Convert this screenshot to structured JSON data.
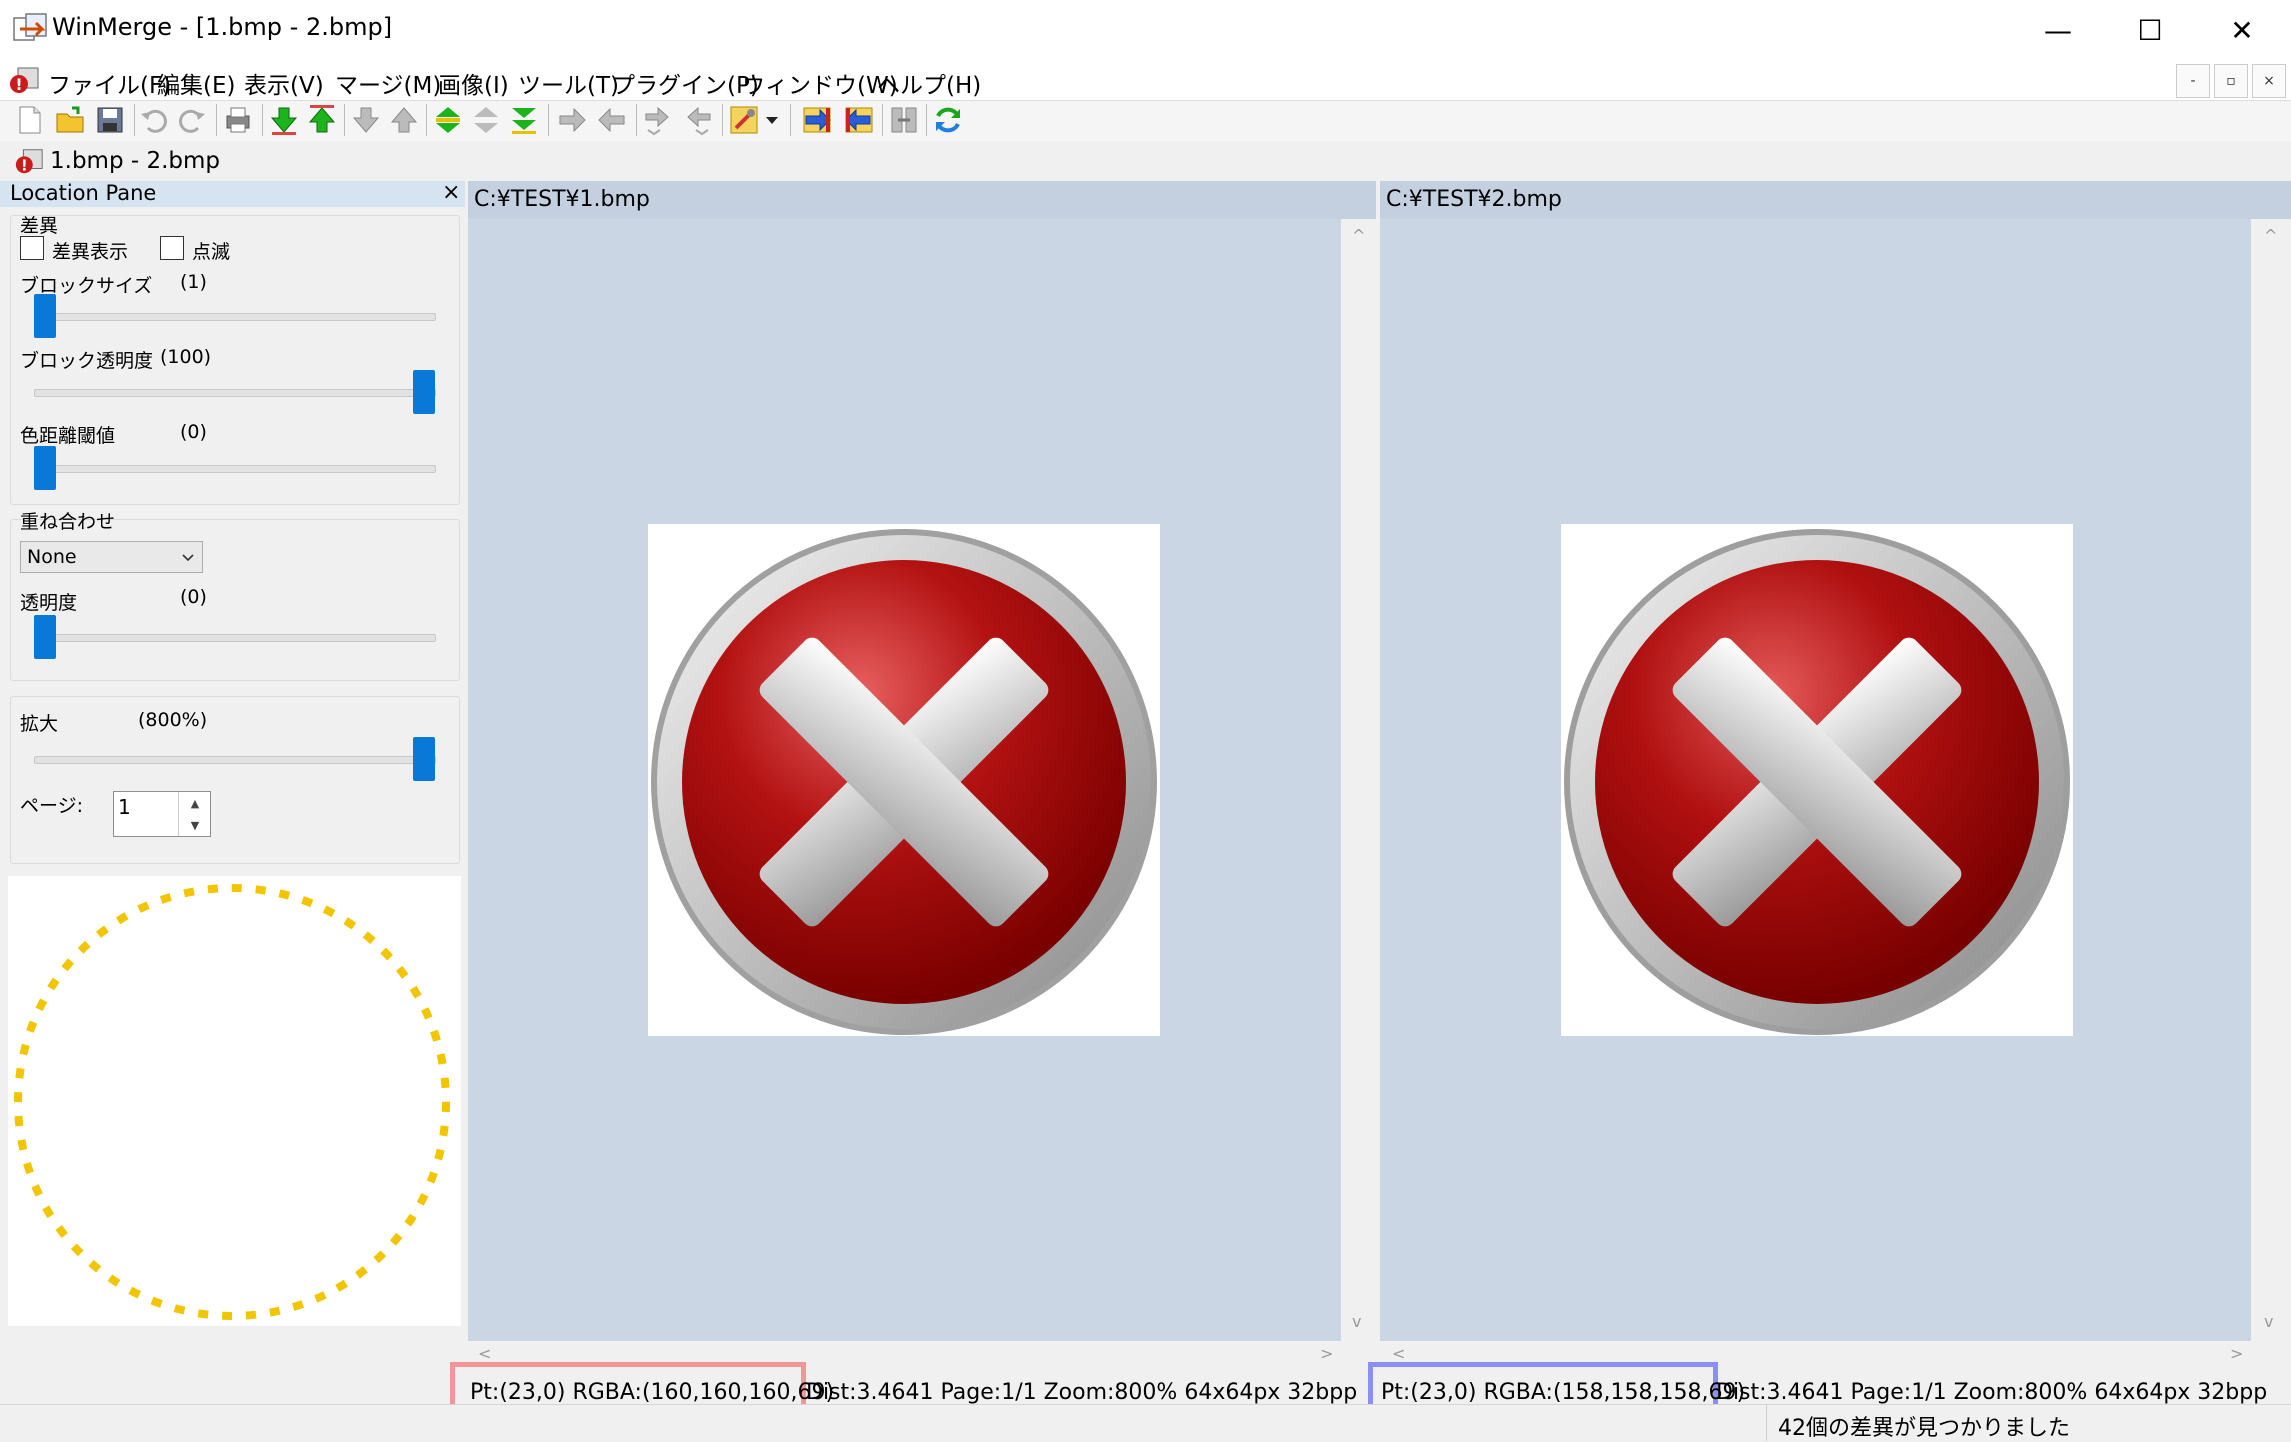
{
  "window": {
    "title": "WinMerge - [1.bmp - 2.bmp]",
    "minimize_glyph": "—",
    "maximize_glyph": "☐",
    "close_glyph": "✕"
  },
  "menu": {
    "items": [
      "ファイル(F)",
      "編集(E)",
      "表示(V)",
      "マージ(M)",
      "画像(I)",
      "ツール(T)",
      "プラグイン(P)",
      "ウィンドウ(W)",
      "ヘルプ(H)"
    ],
    "mdi_min": "-",
    "mdi_restore": "▫",
    "mdi_close": "×"
  },
  "toolbar": {
    "icons": [
      "new-icon",
      "open-icon",
      "save-icon",
      "undo-icon",
      "redo-icon",
      "print-icon",
      "next-diff-icon",
      "prev-diff-icon",
      "first-diff-icon",
      "last-diff-icon",
      "current-diff-icon",
      "next-conflict-icon",
      "prev-conflict-icon",
      "copy-right-icon",
      "copy-left-icon",
      "copy-right-advance-icon",
      "copy-left-advance-icon",
      "options-icon",
      "dropdown-icon",
      "copy-all-right-icon",
      "copy-all-left-icon",
      "merge-icon",
      "refresh-icon"
    ]
  },
  "tab": {
    "label": "1.bmp - 2.bmp"
  },
  "location_pane": {
    "title": "Location Pane",
    "close": "×",
    "diff_group": {
      "title": "差異",
      "show_diff_label": "差異表示",
      "blink_label": "点滅",
      "block_size_label": "ブロックサイズ",
      "block_size_value": "(1)",
      "block_alpha_label": "ブロック透明度",
      "block_alpha_value": "(100)",
      "color_threshold_label": "色距離閾値",
      "color_threshold_value": "(0)"
    },
    "overlay_group": {
      "title": "重ね合わせ",
      "mode_value": "None",
      "alpha_label": "透明度",
      "alpha_value": "(0)"
    },
    "zoom_group": {
      "zoom_label": "拡大",
      "zoom_value": "(800%)",
      "page_label": "ページ:",
      "page_value": "1",
      "spin_up": "▲",
      "spin_down": "▼"
    },
    "preview_color": "#f2c500"
  },
  "panes": {
    "left": {
      "path": "C:¥TEST¥1.bmp",
      "status_highlight": "Pt:(23,0) RGBA:(160,160,160,69)",
      "status_rest": "Dist:3.4641 Page:1/1 Zoom:800% 64x64px 32bpp",
      "highlight_color": "#f09898"
    },
    "right": {
      "path": "C:¥TEST¥2.bmp",
      "status_highlight": "Pt:(23,0) RGBA:(158,158,158,69)",
      "status_rest": "Dist:3.4641 Page:1/1 Zoom:800% 64x64px 32bpp",
      "highlight_color": "#8a8ff2"
    }
  },
  "scroll": {
    "up": "^",
    "down": "v",
    "left": "<",
    "right": ">"
  },
  "statusbar": {
    "diff_count": "42個の差異が見つかりました"
  },
  "colors": {
    "accent": "#0a78d7",
    "pane_bg": "#cbd6e5",
    "pane_header": "#c4cfdf",
    "location_header": "#d6e3f1"
  }
}
